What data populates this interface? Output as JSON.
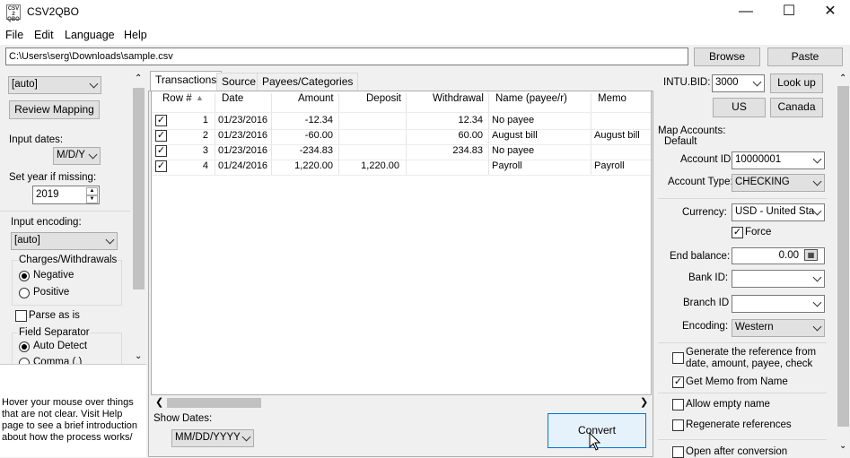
{
  "window": {
    "title": "CSV2QBO",
    "icon_text": "CSV 2 QBO"
  },
  "menu": [
    "File",
    "Edit",
    "Language",
    "Help"
  ],
  "file_path": "C:\\Users\\serg\\Downloads\\sample.csv",
  "buttons": {
    "browse": "Browse",
    "paste": "Paste",
    "review_mapping": "Review Mapping",
    "lookup": "Look up",
    "us": "US",
    "canada": "Canada",
    "convert": "Convert"
  },
  "left": {
    "format_value": "[auto]",
    "input_dates_label": "Input dates:",
    "input_dates_value": "M/D/Y",
    "set_year_label": "Set year if missing:",
    "year_value": "2019",
    "input_encoding_label": "Input encoding:",
    "encoding_value": "[auto]",
    "charges_group": "Charges/Withdrawals",
    "negative": "Negative",
    "positive": "Positive",
    "parse_as_is": "Parse as is",
    "field_separator": "Field Separator",
    "auto_detect": "Auto Detect",
    "comma": "Comma (,)",
    "help_text": "Hover your mouse over things that are not clear. Visit Help page to see a brief introduction about how the process works/"
  },
  "tabs": [
    "Transactions",
    "Source",
    "Payees/Categories"
  ],
  "table": {
    "columns": [
      "Row #",
      "Date",
      "Amount",
      "Deposit",
      "Withdrawal",
      "Name (payee/r)",
      "Memo"
    ],
    "rows": [
      {
        "checked": "✓",
        "row": "1",
        "date": "01/23/2016",
        "amount": "-12.34",
        "deposit": "",
        "withdrawal": "12.34",
        "name": "No payee",
        "memo": ""
      },
      {
        "checked": "✓",
        "row": "2",
        "date": "01/23/2016",
        "amount": "-60.00",
        "deposit": "",
        "withdrawal": "60.00",
        "name": "August bill",
        "memo": "August bill"
      },
      {
        "checked": "✓",
        "row": "3",
        "date": "01/23/2016",
        "amount": "-234.83",
        "deposit": "",
        "withdrawal": "234.83",
        "name": "No payee",
        "memo": ""
      },
      {
        "checked": "✓",
        "row": "4",
        "date": "01/24/2016",
        "amount": "1,220.00",
        "deposit": "1,220.00",
        "withdrawal": "",
        "name": "Payroll",
        "memo": "Payroll"
      }
    ]
  },
  "show_dates_label": "Show Dates:",
  "show_dates_value": "MM/DD/YYYY",
  "right": {
    "intu_bid_label": "INTU.BID:",
    "intu_bid_value": "3000",
    "map_accounts": "Map Accounts:",
    "default": "Default",
    "account_id_label": "Account ID:",
    "account_id_value": "10000001",
    "account_type_label": "Account Type:",
    "account_type_value": "CHECKING",
    "currency_label": "Currency:",
    "currency_value": "USD - United Sta",
    "force": "Force",
    "end_balance_label": "End balance:",
    "end_balance_value": "0.00",
    "bank_id_label": "Bank ID:",
    "branch_id_label": "Branch ID",
    "encoding_label": "Encoding:",
    "encoding_value": "Western",
    "gen_ref": "Generate the reference from date, amount, payee, check",
    "get_memo": "Get Memo from Name",
    "allow_empty": "Allow empty name",
    "regen_refs": "Regenerate references",
    "open_after": "Open after conversion"
  }
}
